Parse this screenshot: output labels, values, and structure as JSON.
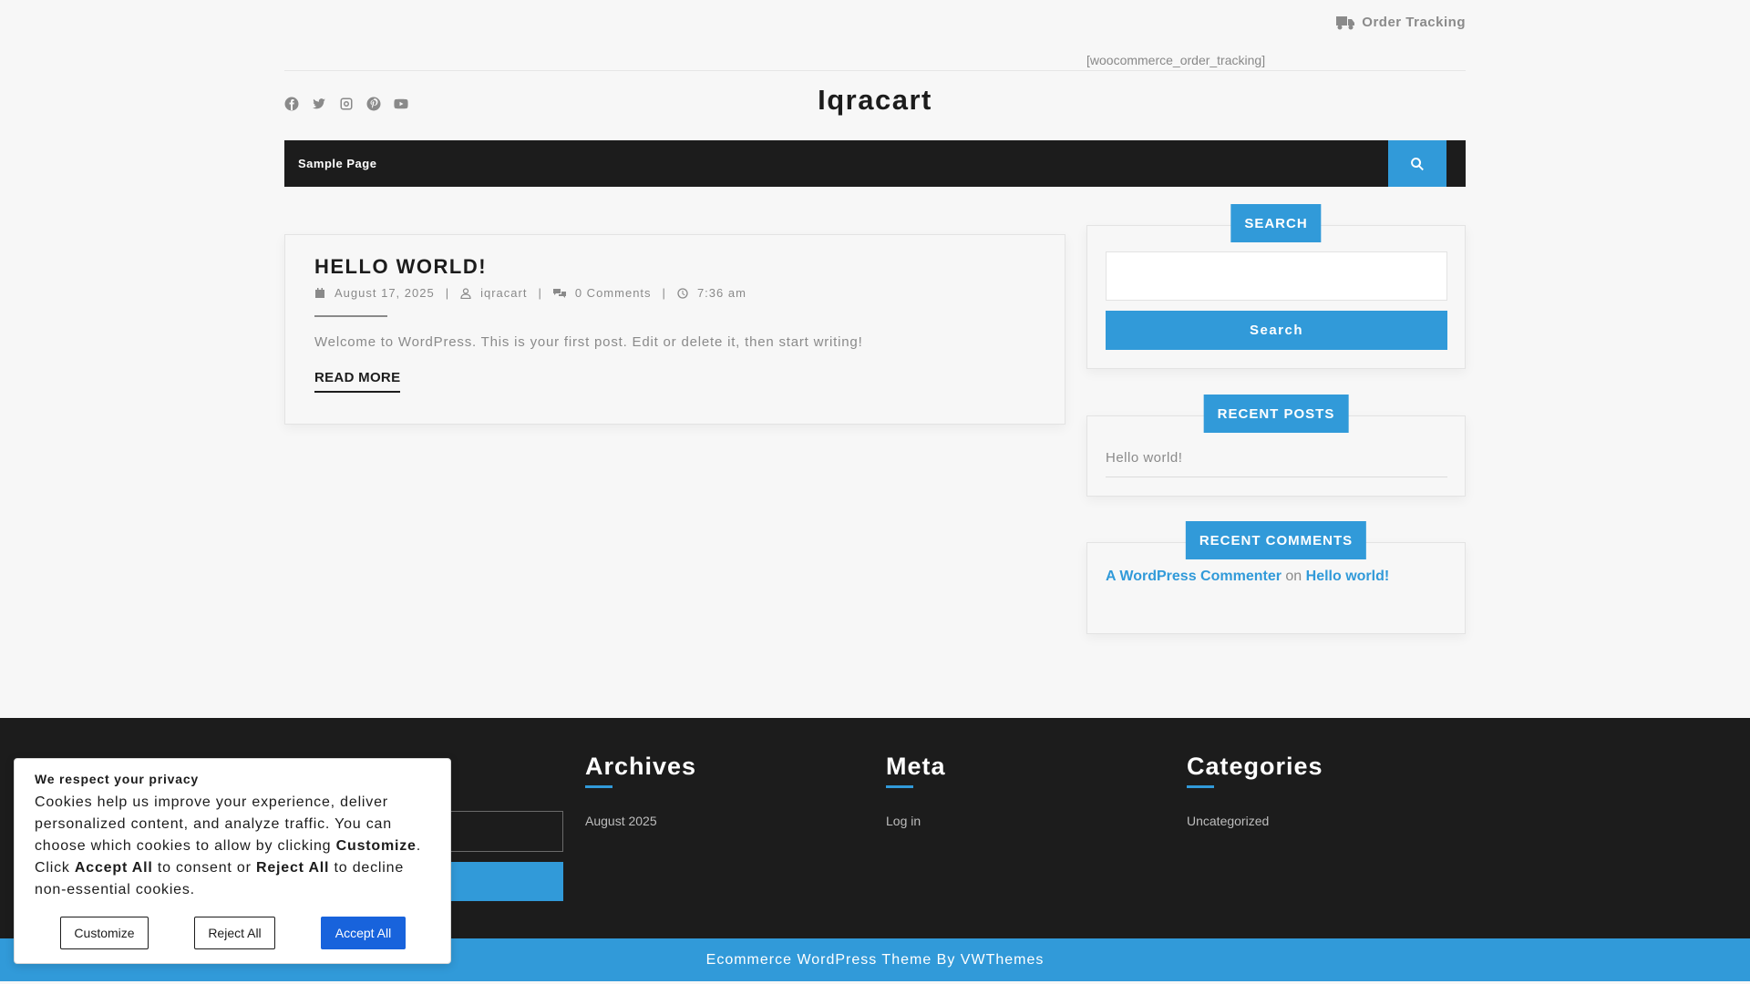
{
  "topbar": {
    "order_tracking_label": "Order Tracking",
    "shortcode_text": "[woocommerce_order_tracking]"
  },
  "brand": {
    "site_title": "Iqracart",
    "socials": [
      "facebook-icon",
      "twitter-icon",
      "instagram-icon",
      "pinterest-icon",
      "youtube-icon"
    ]
  },
  "nav": {
    "items": [
      {
        "label": "Sample Page"
      }
    ],
    "search_icon": "search-icon"
  },
  "post": {
    "title": "HELLO WORLD!",
    "date": "August 17, 2025",
    "author": "iqracart",
    "comments": "0 Comments",
    "time": "7:36 am",
    "excerpt": "Welcome to WordPress. This is your first post. Edit or delete it, then start writing!",
    "read_more": "READ MORE"
  },
  "sidebar": {
    "search": {
      "title": "SEARCH",
      "button": "Search"
    },
    "recent_posts": {
      "title": "RECENT POSTS",
      "items": [
        "Hello world!"
      ]
    },
    "recent_comments": {
      "title": "RECENT COMMENTS",
      "author": "A WordPress Commenter",
      "on": "on",
      "post": "Hello world!"
    }
  },
  "footer": {
    "columns": [
      {
        "title": "Archives",
        "link": "August 2025"
      },
      {
        "title": "Meta",
        "link": "Log in"
      },
      {
        "title": "Categories",
        "link": "Uncategorized"
      }
    ],
    "copyright": "Ecommerce WordPress Theme By VWThemes"
  },
  "cookie": {
    "title": "We respect your privacy",
    "text_1": "Cookies help us improve your experience, deliver personalized content, and analyze traffic. You can choose which cookies to allow by clicking ",
    "text_customize": "Customize",
    "text_2": ". Click ",
    "text_accept": "Accept All",
    "text_3": " to consent or ",
    "text_reject": "Reject All",
    "text_4": " to decline non-essential cookies.",
    "btn_customize": "Customize",
    "btn_reject": "Reject All",
    "btn_accept": "Accept All"
  },
  "colors": {
    "accent": "#319ad9",
    "dark": "#1c1c1c",
    "cookie_accept": "#1863dc"
  }
}
